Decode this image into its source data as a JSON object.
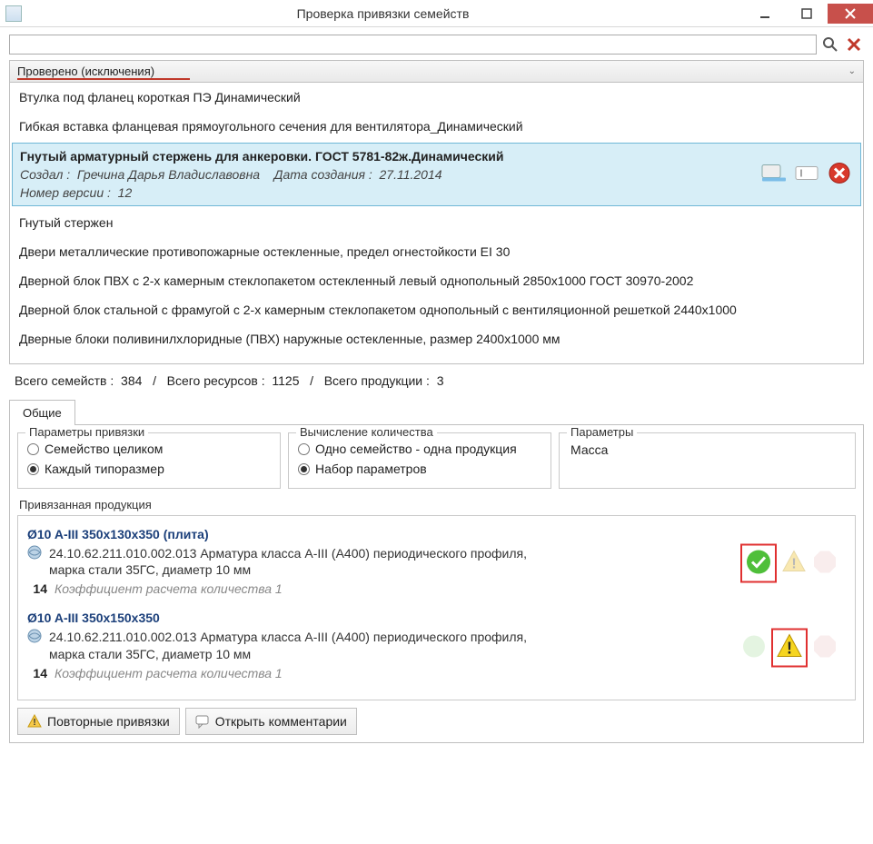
{
  "titlebar": {
    "title": "Проверка привязки семейств"
  },
  "group_header": "Проверено (исключения)",
  "list": {
    "r1": "Втулка под фланец короткая ПЭ Динамический",
    "r2": "Гибкая вставка фланцевая прямоугольного сечения для вентилятора_Динамический",
    "sel_title": "Гнутый арматурный стержень для анкеровки. ГОСТ 5781-82ж.Динамический",
    "sel_meta_author_label": "Создал :",
    "sel_meta_author": "Гречина Дарья Владиславовна",
    "sel_meta_date_label": "Дата создания :",
    "sel_meta_date": "27.11.2014",
    "sel_meta_ver_label": "Номер версии :",
    "sel_meta_ver": "12",
    "r4": "Гнутый стержен",
    "r5": "Двери металлические противопожарные остекленные, предел огнестойкости EI 30",
    "r6": "Дверной блок ПВХ с 2-х камерным стеклопакетом остекленный левый однопольный 2850x1000 ГОСТ 30970-2002",
    "r7": "Дверной блок стальной с фрамугой с 2-х камерным стеклопакетом однопольный с вентиляционной решеткой 2440x1000",
    "r8": "Дверные блоки поливинилхлоридные (ПВХ) наружные остекленные, размер 2400x1000 мм"
  },
  "status": {
    "families_label": "Всего семейств :",
    "families": "384",
    "sep": "/",
    "resources_label": "Всего ресурсов :",
    "resources": "1125",
    "products_label": "Всего продукции :",
    "products": "3"
  },
  "tabs": {
    "general": "Общие"
  },
  "param_binding": {
    "legend": "Параметры привязки",
    "whole": "Семейство целиком",
    "each": "Каждый типоразмер"
  },
  "qty_calc": {
    "legend": "Вычисление количества",
    "one": "Одно семейство - одна продукция",
    "set": "Набор параметров"
  },
  "params": {
    "legend": "Параметры",
    "mass": "Масса"
  },
  "bound_legend": "Привязанная продукция",
  "products": [
    {
      "title": "Ø10 A-III 350x130x350 (плита)",
      "desc": "24.10.62.211.010.002.013 Арматура класса A-III (А400) периодического профиля, марка стали 35ГС, диаметр 10 мм",
      "coeff_num": "14",
      "coeff_txt": "Коэффициент расчета количества 1",
      "highlight": "green"
    },
    {
      "title": "Ø10 A-III 350x150x350",
      "desc": "24.10.62.211.010.002.013 Арматура класса A-III (А400) периодического профиля, марка стали 35ГС, диаметр 10 мм",
      "coeff_num": "14",
      "coeff_txt": "Коэффициент расчета количества 1",
      "highlight": "yellow"
    }
  ],
  "footer": {
    "repeat": "Повторные привязки",
    "comments": "Открыть комментарии"
  }
}
